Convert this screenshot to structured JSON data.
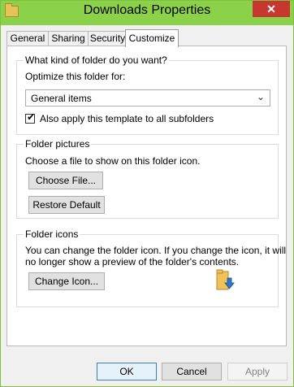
{
  "window": {
    "title": "Downloads Properties",
    "close": "✕"
  },
  "tabs": [
    {
      "label": "General"
    },
    {
      "label": "Sharing"
    },
    {
      "label": "Security"
    },
    {
      "label": "Customize",
      "active": true
    }
  ],
  "folder_type": {
    "heading": "What kind of folder do you want?",
    "optimize_label": "Optimize this folder for:",
    "selected": "General items",
    "apply_checkbox_label": "Also apply this template to all subfolders",
    "apply_checked": true
  },
  "folder_pictures": {
    "heading": "Folder pictures",
    "description": "Choose a file to show on this folder icon.",
    "choose_button": "Choose File...",
    "restore_button": "Restore Default"
  },
  "folder_icons": {
    "heading": "Folder icons",
    "description_line1": "You can change the folder icon. If you change the icon, it will",
    "description_line2": "no longer show a preview of the folder's contents.",
    "change_button": "Change Icon..."
  },
  "footer": {
    "ok": "OK",
    "cancel": "Cancel",
    "apply": "Apply"
  },
  "colors": {
    "titlebar": "#8cd14a",
    "close": "#c7372f"
  },
  "icons": {
    "app": "folder-icon",
    "preview": "downloads-folder-icon"
  }
}
